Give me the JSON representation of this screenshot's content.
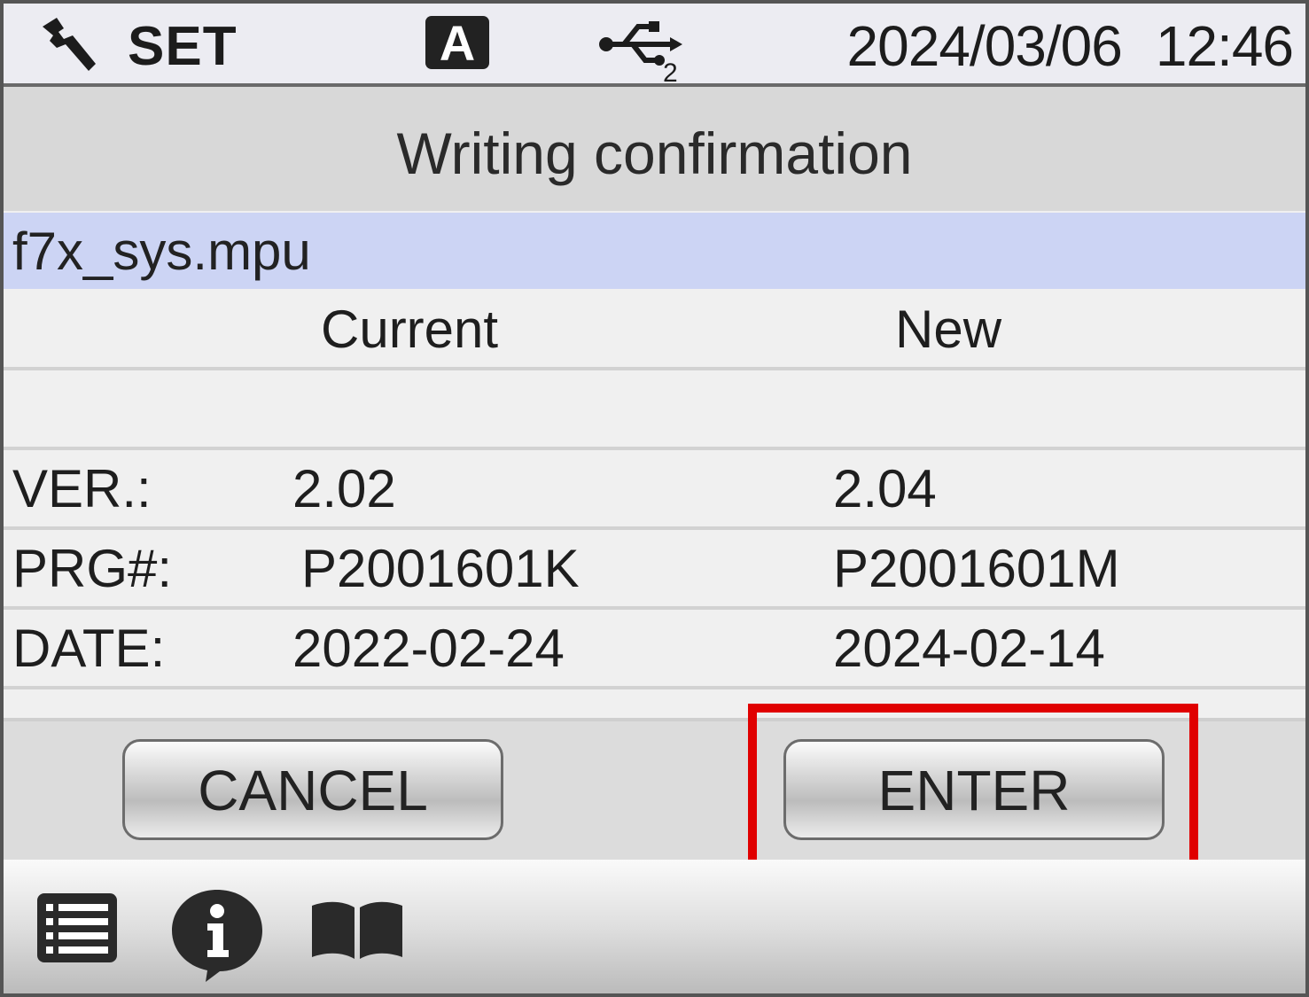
{
  "status_bar": {
    "settings_icon": "wrench-icon",
    "mode_label": "SET",
    "mode_badge": "A",
    "usb_icon": "usb-icon",
    "usb_port": "2",
    "date": "2024/03/06",
    "time": "12:46"
  },
  "dialog": {
    "title": "Writing confirmation",
    "file_name": "f7x_sys.mpu",
    "column_current": "Current",
    "column_new": "New",
    "rows": [
      {
        "label": "VER.:",
        "current": "2.02",
        "new": "2.04"
      },
      {
        "label": "PRG#:",
        "current": "P2001601K",
        "new": "P2001601M"
      },
      {
        "label": "DATE:",
        "current": "2022-02-24",
        "new": "2024-02-14"
      }
    ],
    "cancel_label": "CANCEL",
    "enter_label": "ENTER"
  },
  "toolbar": {
    "icons": [
      "list-menu-icon",
      "info-icon",
      "manual-book-icon"
    ]
  },
  "colors": {
    "file_row": "#ccd4f4",
    "highlight": "#e00000",
    "title_bar": "#d8d8d8"
  }
}
